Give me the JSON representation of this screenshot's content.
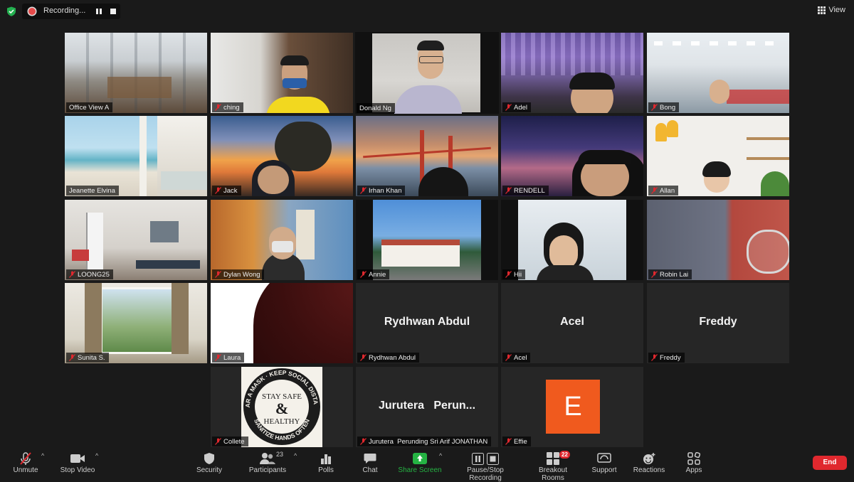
{
  "recording": {
    "label": "Recording..."
  },
  "view": {
    "label": "View"
  },
  "colors": {
    "active_border": "#d6d84a",
    "mic_muted": "#e0282e",
    "end_button": "#e0282e",
    "share_screen": "#25b343"
  },
  "participants": [
    {
      "id": "office-view-a",
      "name": "Office View A",
      "muted": false
    },
    {
      "id": "ching",
      "name": "ching",
      "muted": true
    },
    {
      "id": "donald-ng",
      "name": "Donald Ng",
      "muted": false,
      "active_speaker": true
    },
    {
      "id": "adel",
      "name": "Adel",
      "muted": true
    },
    {
      "id": "bong",
      "name": "Bong",
      "muted": true
    },
    {
      "id": "jeanette-elvina",
      "name": "Jeanette Elvina",
      "muted": false
    },
    {
      "id": "jack",
      "name": "Jack",
      "muted": true
    },
    {
      "id": "irhan-khan",
      "name": "Irhan Khan",
      "muted": true
    },
    {
      "id": "rendell",
      "name": "RENDELL",
      "muted": true
    },
    {
      "id": "allan",
      "name": "Allan",
      "muted": true
    },
    {
      "id": "loong25",
      "name": "LOONG25",
      "muted": true
    },
    {
      "id": "dylan-wong",
      "name": "Dylan Wong",
      "muted": true
    },
    {
      "id": "annie",
      "name": "Annie",
      "muted": true
    },
    {
      "id": "hii",
      "name": "Hii",
      "muted": true
    },
    {
      "id": "robin-lai",
      "name": "Robin Lai",
      "muted": true
    },
    {
      "id": "sunita",
      "name": "Sunita S.",
      "muted": true
    },
    {
      "id": "laura",
      "name": "Laura",
      "muted": true
    },
    {
      "id": "rydhwan-abdul",
      "name": "Rydhwan Abdul",
      "display": "Rydhwan Abdul",
      "muted": true
    },
    {
      "id": "acel",
      "name": "Acel",
      "display": "Acel",
      "muted": true
    },
    {
      "id": "freddy",
      "name": "Freddy",
      "display": "Freddy",
      "muted": true
    },
    {
      "id": "collete",
      "name": "Collete",
      "muted": true,
      "poster": {
        "arc_top": "WEAR A MASK · KEEP SOCIAL DISTANCE",
        "arc_bottom": "SANITIZE HANDS OFTEN",
        "center_line1": "STAY SAFE",
        "center_amp": "&",
        "center_line2": "HEALTHY"
      }
    },
    {
      "id": "jurutera",
      "name": "Jurutera  Perunding Sri Arif JONATHAN",
      "display": "Jurutera   Perun...",
      "muted": true
    },
    {
      "id": "effie",
      "name": "Effie",
      "muted": true,
      "avatar_letter": "E",
      "avatar_color": "#f05a1e"
    }
  ],
  "toolbar": {
    "unmute": "Unmute",
    "stop_video": "Stop Video",
    "security": "Security",
    "participants": "Participants",
    "participants_count": "23",
    "polls": "Polls",
    "chat": "Chat",
    "share_screen": "Share Screen",
    "pause_recording": "Pause/Stop Recording",
    "breakout_rooms": "Breakout Rooms",
    "breakout_count": "22",
    "support": "Support",
    "reactions": "Reactions",
    "apps": "Apps",
    "end": "End"
  }
}
